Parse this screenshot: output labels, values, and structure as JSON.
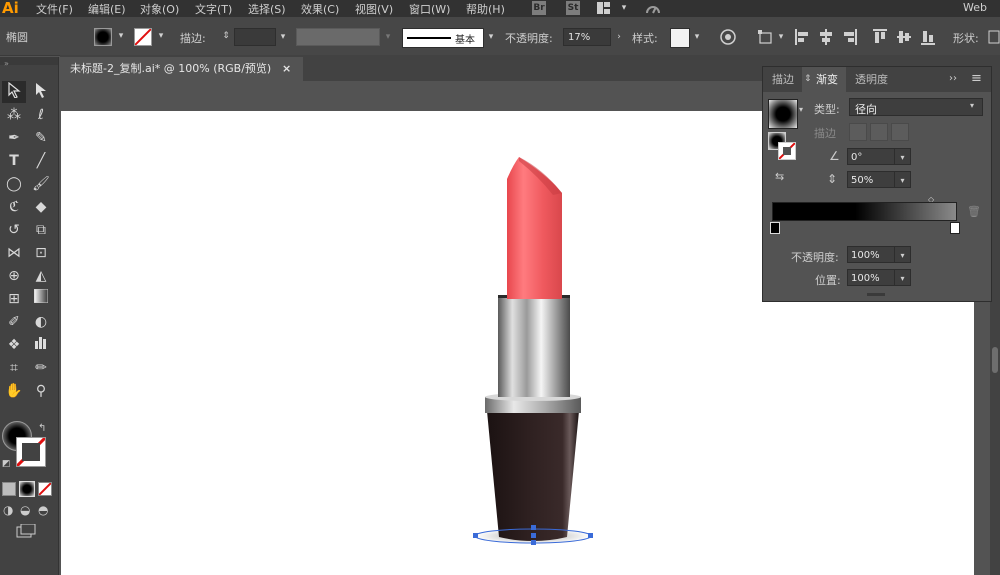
{
  "app": {
    "logo": "Ai",
    "workspace": "Web"
  },
  "menu": [
    "文件(F)",
    "编辑(E)",
    "对象(O)",
    "文字(T)",
    "选择(S)",
    "效果(C)",
    "视图(V)",
    "窗口(W)",
    "帮助(H)"
  ],
  "bridge": {
    "br": "Br",
    "st": "St"
  },
  "control": {
    "object_type": "椭圆",
    "stroke_label": "描边:",
    "stroke_profile": "基本",
    "opacity_label": "不透明度:",
    "opacity_value": "17%",
    "style_label": "样式:",
    "shape_label": "形状:"
  },
  "document": {
    "tab_title": "未标题-2_复制.ai* @ 100% (RGB/预览)",
    "close": "×"
  },
  "panel": {
    "tabs": [
      "描边",
      "渐变",
      "透明度"
    ],
    "type_label": "类型:",
    "type_value": "径向",
    "stroke_label": "描边",
    "angle_value": "0°",
    "aspect_value": "50%",
    "opacity_label": "不透明度:",
    "opacity_value": "100%",
    "location_label": "位置:",
    "location_value": "100%",
    "menu_icon": "≡"
  },
  "colors": {
    "ui_dark": "#323232",
    "ui_mid": "#474747",
    "ui_panel": "#535353",
    "accent_logo": "#ff9a00",
    "lipstick": "#f35a5e",
    "case": "#2a1d1d",
    "selection": "#3a6bd8"
  }
}
